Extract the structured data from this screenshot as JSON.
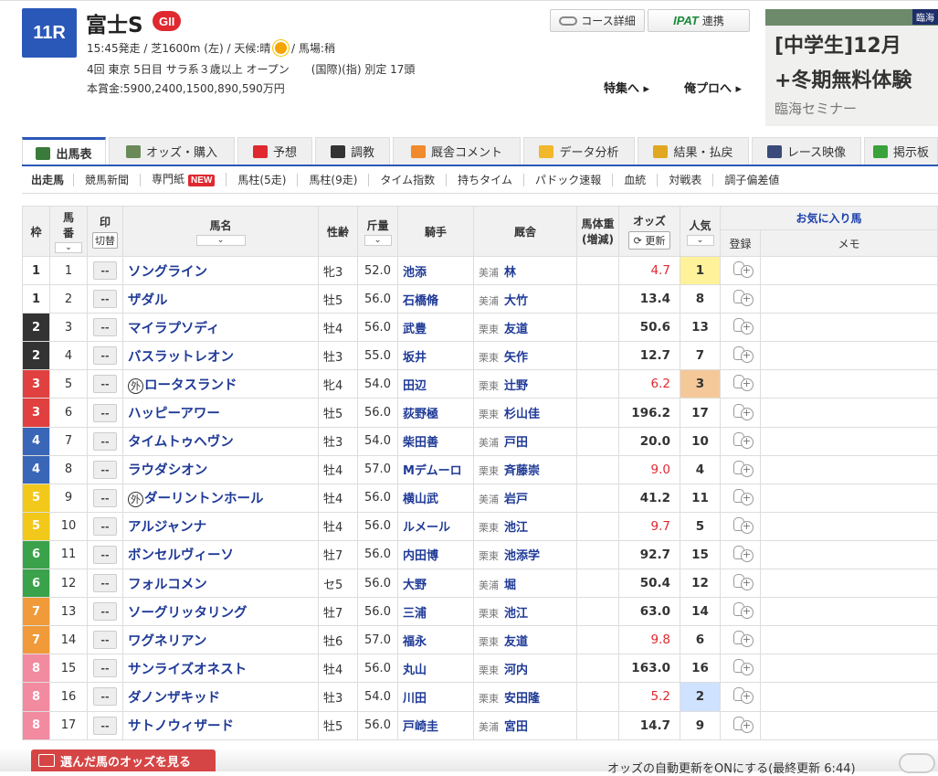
{
  "race": {
    "number": "11R",
    "name": "富士S",
    "grade": "GII",
    "line1_pre": "15:45発走 / 芝1600m (左) / 天候:晴",
    "line1_post": "/ 馬場:稍",
    "line2": "4回 東京 5日目 サラ系３歳以上 オープン　　(国際)(指) 別定 17頭",
    "line3": "本賞金:5900,2400,1500,890,590万円"
  },
  "weather_icon": "sun-icon",
  "header_buttons": {
    "course": "コース詳細",
    "ipat_logo": "IPAT",
    "ipat_label": "連携"
  },
  "links": {
    "special": "特集へ ▸",
    "pro": "俺プロへ ▸"
  },
  "ad": {
    "line1": "[中学生]12月",
    "line2": "+冬期無料体験",
    "line3": "臨海セミナー",
    "badge": "臨海"
  },
  "tabs": [
    {
      "label": "出馬表",
      "icon": "table-icon",
      "color": "#3a7a3a"
    },
    {
      "label": "オッズ・購入",
      "icon": "ticket-icon",
      "color": "#6a8a5a"
    },
    {
      "label": "予想",
      "icon": "target-icon",
      "color": "#e0282f"
    },
    {
      "label": "調教",
      "icon": "stopwatch-icon",
      "color": "#333"
    },
    {
      "label": "厩舎コメント",
      "icon": "helmet-icon",
      "color": "#f08a2a"
    },
    {
      "label": "データ分析",
      "icon": "bar-chart-icon",
      "color": "#f0b82a"
    },
    {
      "label": "結果・払戻",
      "icon": "coins-icon",
      "color": "#e0a820"
    },
    {
      "label": "レース映像",
      "icon": "film-icon",
      "color": "#3a4a7a"
    },
    {
      "label": "掲示板",
      "icon": "speech-icon",
      "color": "#3aa23a"
    }
  ],
  "subnav": [
    "出走馬",
    "競馬新聞",
    "専門紙",
    "馬柱(5走)",
    "馬柱(9走)",
    "タイム指数",
    "持ちタイム",
    "パドック速報",
    "血統",
    "対戦表",
    "調子偏差値"
  ],
  "new_badge": "NEW",
  "table_headers": {
    "waku": "枠",
    "umaban": "馬\n番",
    "mark": "印",
    "mark_toggle": "切替",
    "name": "馬名",
    "sexage": "性齢",
    "weight": "斤量",
    "jockey": "騎手",
    "stable": "厩舎",
    "bodyweight": "馬体重\n(増減)",
    "odds": "オッズ",
    "odds_update": "更新",
    "popularity": "人気",
    "favorites": "お気に入り馬",
    "register": "登録",
    "memo": "メモ",
    "sort_arrow": "⌄",
    "mark_value": "--"
  },
  "waku_colors": {
    "1": [
      "#ffffff",
      "#333"
    ],
    "2": [
      "#333333",
      "#fff"
    ],
    "3": [
      "#e0403f",
      "#fff"
    ],
    "4": [
      "#3a66b8",
      "#fff"
    ],
    "5": [
      "#f2c81a",
      "#fff"
    ],
    "6": [
      "#3aa24a",
      "#fff"
    ],
    "7": [
      "#f09a3a",
      "#fff"
    ],
    "8": [
      "#f28aa0",
      "#fff"
    ]
  },
  "pop_highlight": {
    "1": "#fff29a",
    "2": "#cfe2ff",
    "3": "#f5c89a"
  },
  "horses": [
    {
      "waku": "1",
      "num": "1",
      "gai": false,
      "name": "ソングライン",
      "sexage": "牝3",
      "weight": "52.0",
      "jockey": "池添",
      "region": "美浦",
      "trainer": "林",
      "odds": "4.7",
      "pop": "1"
    },
    {
      "waku": "1",
      "num": "2",
      "gai": false,
      "name": "ザダル",
      "sexage": "牡5",
      "weight": "56.0",
      "jockey": "石橋脩",
      "region": "美浦",
      "trainer": "大竹",
      "odds": "13.4",
      "pop": "8"
    },
    {
      "waku": "2",
      "num": "3",
      "gai": false,
      "name": "マイラプソディ",
      "sexage": "牡4",
      "weight": "56.0",
      "jockey": "武豊",
      "region": "栗東",
      "trainer": "友道",
      "odds": "50.6",
      "pop": "13"
    },
    {
      "waku": "2",
      "num": "4",
      "gai": false,
      "name": "バスラットレオン",
      "sexage": "牡3",
      "weight": "55.0",
      "jockey": "坂井",
      "region": "栗東",
      "trainer": "矢作",
      "odds": "12.7",
      "pop": "7"
    },
    {
      "waku": "3",
      "num": "5",
      "gai": true,
      "name": "ロータスランド",
      "sexage": "牝4",
      "weight": "54.0",
      "jockey": "田辺",
      "region": "栗東",
      "trainer": "辻野",
      "odds": "6.2",
      "pop": "3"
    },
    {
      "waku": "3",
      "num": "6",
      "gai": false,
      "name": "ハッピーアワー",
      "sexage": "牡5",
      "weight": "56.0",
      "jockey": "荻野極",
      "region": "栗東",
      "trainer": "杉山佳",
      "odds": "196.2",
      "pop": "17"
    },
    {
      "waku": "4",
      "num": "7",
      "gai": false,
      "name": "タイムトゥヘヴン",
      "sexage": "牡3",
      "weight": "54.0",
      "jockey": "柴田善",
      "region": "美浦",
      "trainer": "戸田",
      "odds": "20.0",
      "pop": "10"
    },
    {
      "waku": "4",
      "num": "8",
      "gai": false,
      "name": "ラウダシオン",
      "sexage": "牡4",
      "weight": "57.0",
      "jockey": "Mデムーロ",
      "region": "栗東",
      "trainer": "斉藤崇",
      "odds": "9.0",
      "pop": "4"
    },
    {
      "waku": "5",
      "num": "9",
      "gai": true,
      "name": "ダーリントンホール",
      "sexage": "牡4",
      "weight": "56.0",
      "jockey": "横山武",
      "region": "美浦",
      "trainer": "岩戸",
      "odds": "41.2",
      "pop": "11"
    },
    {
      "waku": "5",
      "num": "10",
      "gai": false,
      "name": "アルジャンナ",
      "sexage": "牡4",
      "weight": "56.0",
      "jockey": "ルメール",
      "region": "栗東",
      "trainer": "池江",
      "odds": "9.7",
      "pop": "5"
    },
    {
      "waku": "6",
      "num": "11",
      "gai": false,
      "name": "ボンセルヴィーソ",
      "sexage": "牡7",
      "weight": "56.0",
      "jockey": "内田博",
      "region": "栗東",
      "trainer": "池添学",
      "odds": "92.7",
      "pop": "15"
    },
    {
      "waku": "6",
      "num": "12",
      "gai": false,
      "name": "フォルコメン",
      "sexage": "セ5",
      "weight": "56.0",
      "jockey": "大野",
      "region": "美浦",
      "trainer": "堀",
      "odds": "50.4",
      "pop": "12"
    },
    {
      "waku": "7",
      "num": "13",
      "gai": false,
      "name": "ソーグリッタリング",
      "sexage": "牡7",
      "weight": "56.0",
      "jockey": "三浦",
      "region": "栗東",
      "trainer": "池江",
      "odds": "63.0",
      "pop": "14"
    },
    {
      "waku": "7",
      "num": "14",
      "gai": false,
      "name": "ワグネリアン",
      "sexage": "牡6",
      "weight": "57.0",
      "jockey": "福永",
      "region": "栗東",
      "trainer": "友道",
      "odds": "9.8",
      "pop": "6"
    },
    {
      "waku": "8",
      "num": "15",
      "gai": false,
      "name": "サンライズオネスト",
      "sexage": "牡4",
      "weight": "56.0",
      "jockey": "丸山",
      "region": "栗東",
      "trainer": "河内",
      "odds": "163.0",
      "pop": "16"
    },
    {
      "waku": "8",
      "num": "16",
      "gai": false,
      "name": "ダノンザキッド",
      "sexage": "牡3",
      "weight": "54.0",
      "jockey": "川田",
      "region": "栗東",
      "trainer": "安田隆",
      "odds": "5.2",
      "pop": "2"
    },
    {
      "waku": "8",
      "num": "17",
      "gai": false,
      "name": "サトノウィザード",
      "sexage": "牡5",
      "weight": "56.0",
      "jockey": "戸崎圭",
      "region": "美浦",
      "trainer": "宮田",
      "odds": "14.7",
      "pop": "9"
    }
  ],
  "gai_label": "外",
  "bottom": {
    "button": "選んだ馬のオッズを見る",
    "auto_update": "オッズの自動更新をONにする(最終更新 6:44)"
  }
}
